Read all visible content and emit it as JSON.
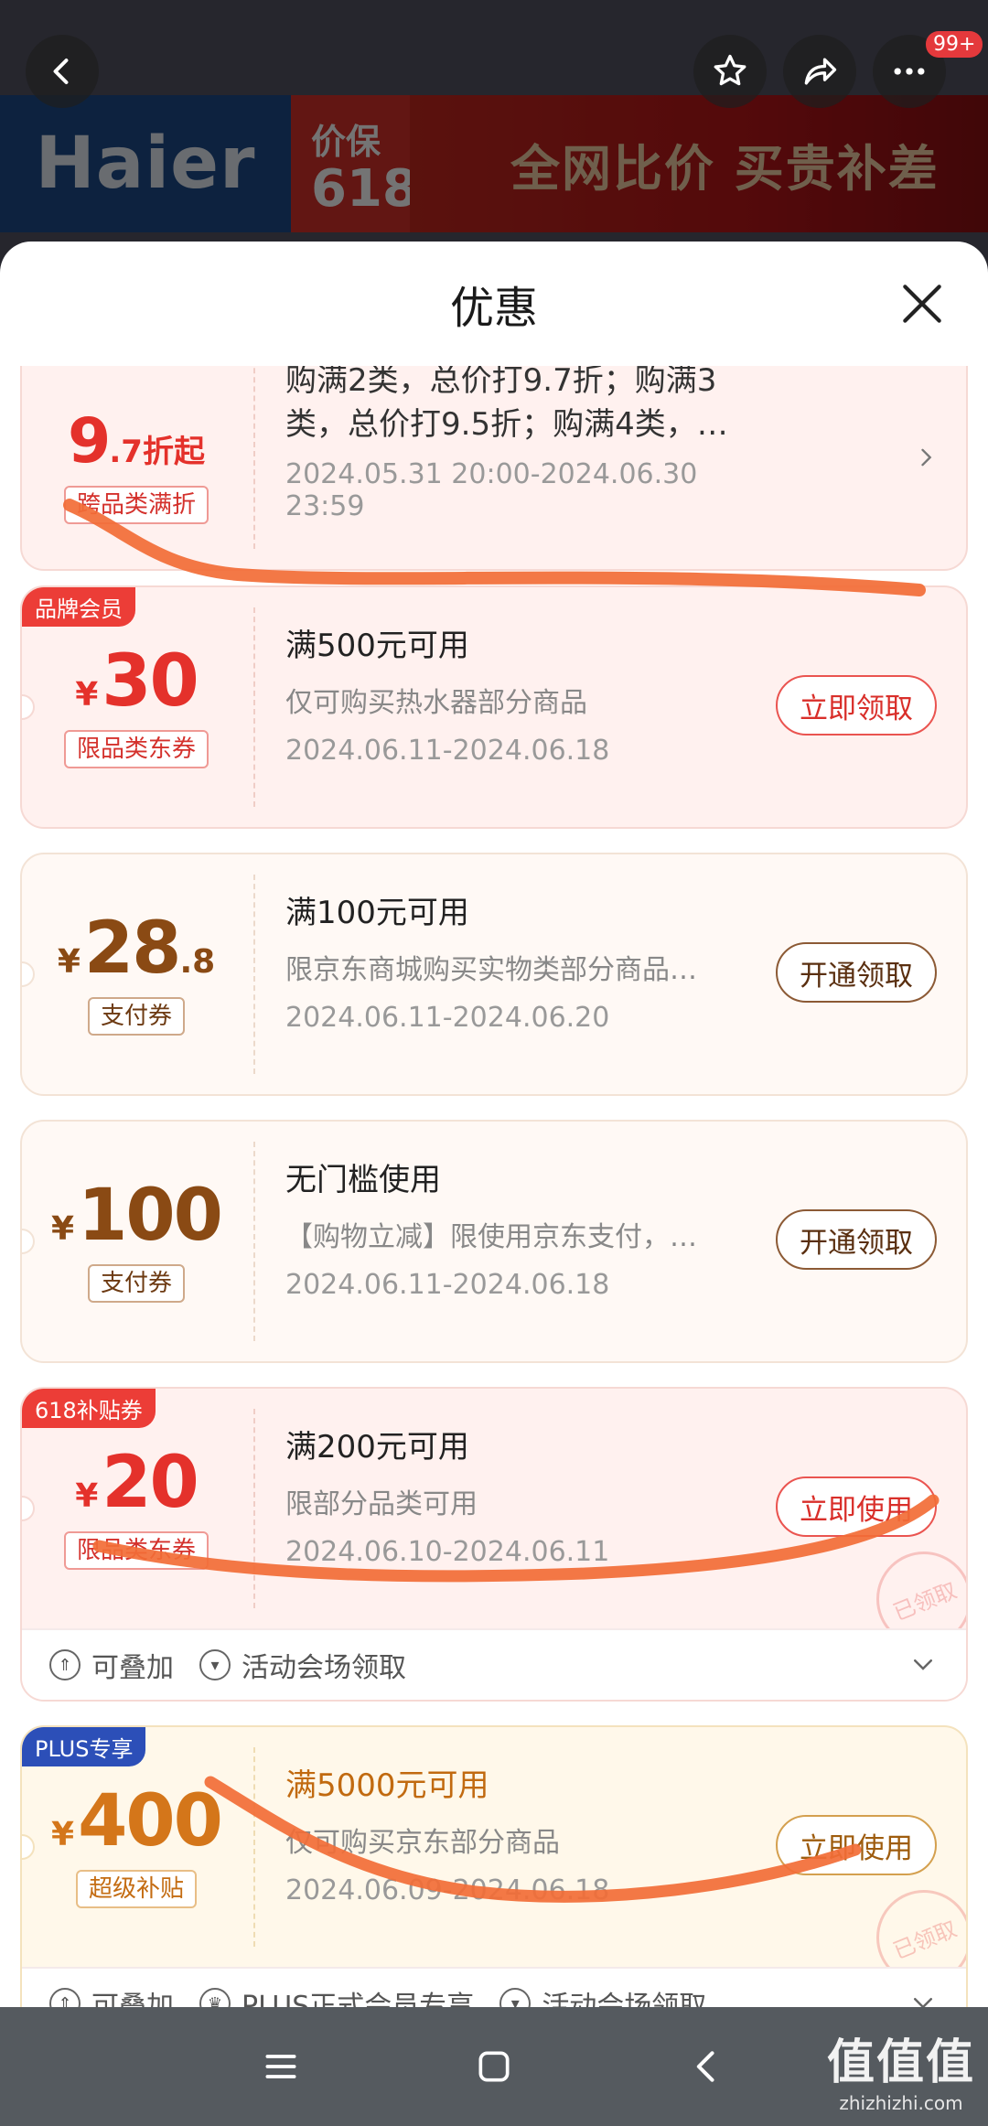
{
  "page": {
    "header": {
      "notification_badge": "99+"
    },
    "banner": {
      "brand": "Haier",
      "tag_line1": "价保",
      "tag_line2": "618",
      "slogan": "全网比价 买贵补差"
    },
    "sheet": {
      "title": "优惠"
    },
    "coupons": [
      {
        "amount_main": "9",
        "amount_suffix": ".7折起",
        "type_label": "跨品类满折",
        "description": "购满2类，总价打9.7折；购满3类，总价打9.5折；购满4类，…",
        "description_line1": "购满2类，总价打9.7折；购满3",
        "description_line2": "类，总价打9.5折；购满4类，…",
        "date": "2024.05.31 20:00-2024.06.30 23:59"
      },
      {
        "corner_tag": "品牌会员",
        "currency": "¥",
        "amount_main": "30",
        "type_label": "限品类东券",
        "condition": "满500元可用",
        "description": "仅可购买热水器部分商品",
        "date": "2024.06.11-2024.06.18",
        "button": "立即领取"
      },
      {
        "currency": "¥",
        "amount_main": "28",
        "amount_decimal": ".8",
        "type_label": "支付券",
        "condition": "满100元可用",
        "description": "限京东商城购买实物类部分商品…",
        "date": "2024.06.11-2024.06.20",
        "button": "开通领取"
      },
      {
        "currency": "¥",
        "amount_main": "100",
        "type_label": "支付券",
        "condition": "无门槛使用",
        "description": "【购物立减】限使用京东支付，…",
        "date": "2024.06.11-2024.06.18",
        "button": "开通领取"
      },
      {
        "corner_tag": "618补贴券",
        "currency": "¥",
        "amount_main": "20",
        "type_label": "限品类东券",
        "condition": "满200元可用",
        "description": "限部分品类可用",
        "date": "2024.06.10-2024.06.11",
        "button": "立即使用",
        "stamp": "已领取",
        "footer": [
          "可叠加",
          "活动会场领取"
        ]
      },
      {
        "corner_tag": "PLUS专享",
        "currency": "¥",
        "amount_main": "400",
        "type_label": "超级补贴",
        "condition": "满5000元可用",
        "description": "仅可购买京东部分商品",
        "date": "2024.06.09-2024.06.18",
        "button": "立即使用",
        "stamp": "已领取",
        "footer": [
          "可叠加",
          "PLUS正式会员专享",
          "活动会场领取"
        ]
      }
    ],
    "watermark": {
      "title": "值值值",
      "site": "zhizhizhi.com"
    }
  },
  "colors": {
    "accent_red": "#e4312b",
    "brown": "#8a4a14",
    "gold": "#d4761a",
    "plus_blue": "#2c4fb8",
    "scribble": "#f26c36"
  },
  "icons": [
    "back-arrow-icon",
    "star-icon",
    "share-icon",
    "more-icon",
    "close-icon",
    "chevron-right-icon",
    "chevron-down-icon",
    "stack-icon",
    "venue-icon",
    "crown-icon",
    "menu-icon",
    "home-square-icon",
    "nav-back-icon"
  ]
}
